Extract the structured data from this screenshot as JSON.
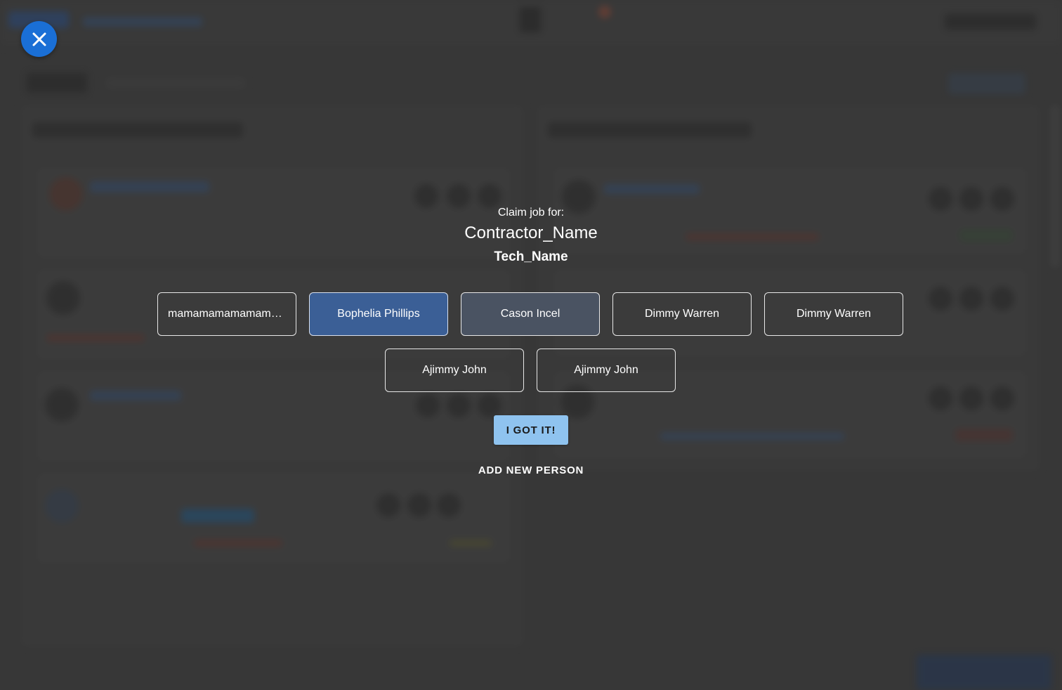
{
  "modal": {
    "claim_label": "Claim job for:",
    "contractor_name": "Contractor_Name",
    "tech_name": "Tech_Name",
    "people": [
      {
        "label": "mamamamamamamam...",
        "state": "normal"
      },
      {
        "label": "Bophelia Phillips",
        "state": "selected"
      },
      {
        "label": "Cason Incel",
        "state": "hovered"
      },
      {
        "label": "Dimmy Warren",
        "state": "normal"
      },
      {
        "label": "Dimmy Warren",
        "state": "normal"
      },
      {
        "label": "Ajimmy John",
        "state": "normal"
      },
      {
        "label": "Ajimmy John",
        "state": "normal"
      }
    ],
    "confirm_label": "I GOT IT!",
    "add_person_label": "ADD NEW PERSON"
  },
  "colors": {
    "close_button": "#1a6fd6",
    "selected_person": "#3b5f96",
    "confirm_button": "#8fc3ef",
    "backdrop": "#3f3f3f"
  },
  "icons": {
    "close": "close-icon"
  }
}
